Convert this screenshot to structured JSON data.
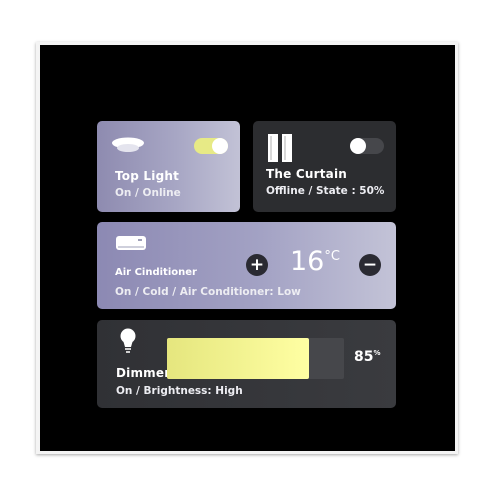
{
  "top_light": {
    "title": "Top Light",
    "status": "On / Online",
    "icon": "ceiling-lamp-icon",
    "toggle_on": true
  },
  "curtain": {
    "title": "The Curtain",
    "status": "Offline / State : 50%",
    "icon": "curtain-icon",
    "toggle_on": false
  },
  "air_conditioner": {
    "title": "Air Cinditioner",
    "status": "On / Cold / Air Conditioner: Low",
    "icon": "air-conditioner-icon",
    "plus_label": "+",
    "minus_label": "−",
    "temperature": "16",
    "temperature_unit": "°C"
  },
  "dimmer": {
    "title": "Dimmer",
    "status": "On / Brightness: High",
    "icon": "light-bulb-icon",
    "value": "85",
    "value_unit": "%",
    "fill_fraction": 0.8
  },
  "colors": {
    "accent": "#e7ea86",
    "card_active": "#a7a6c4",
    "card_inactive": "#2c2d30",
    "background": "#000000"
  }
}
